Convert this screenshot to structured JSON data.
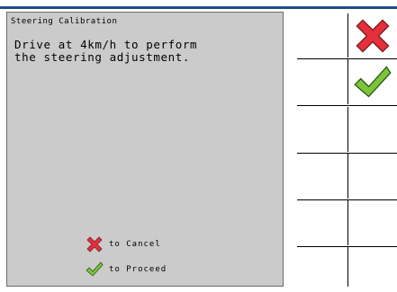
{
  "dialog": {
    "title": "Steering Calibration",
    "message_line1": "Drive at 4km/h to perform",
    "message_line2": "the steering adjustment.",
    "cancel_hint": "to Cancel",
    "proceed_hint": "to Proceed"
  },
  "icons": {
    "cancel": "cancel-x-icon",
    "proceed": "checkmark-icon"
  },
  "colors": {
    "accent_line": "#1f4f8a",
    "cancel_red": "#e52f3c",
    "proceed_green": "#7bc53c",
    "dialog_bg": "#cbcbcb"
  }
}
